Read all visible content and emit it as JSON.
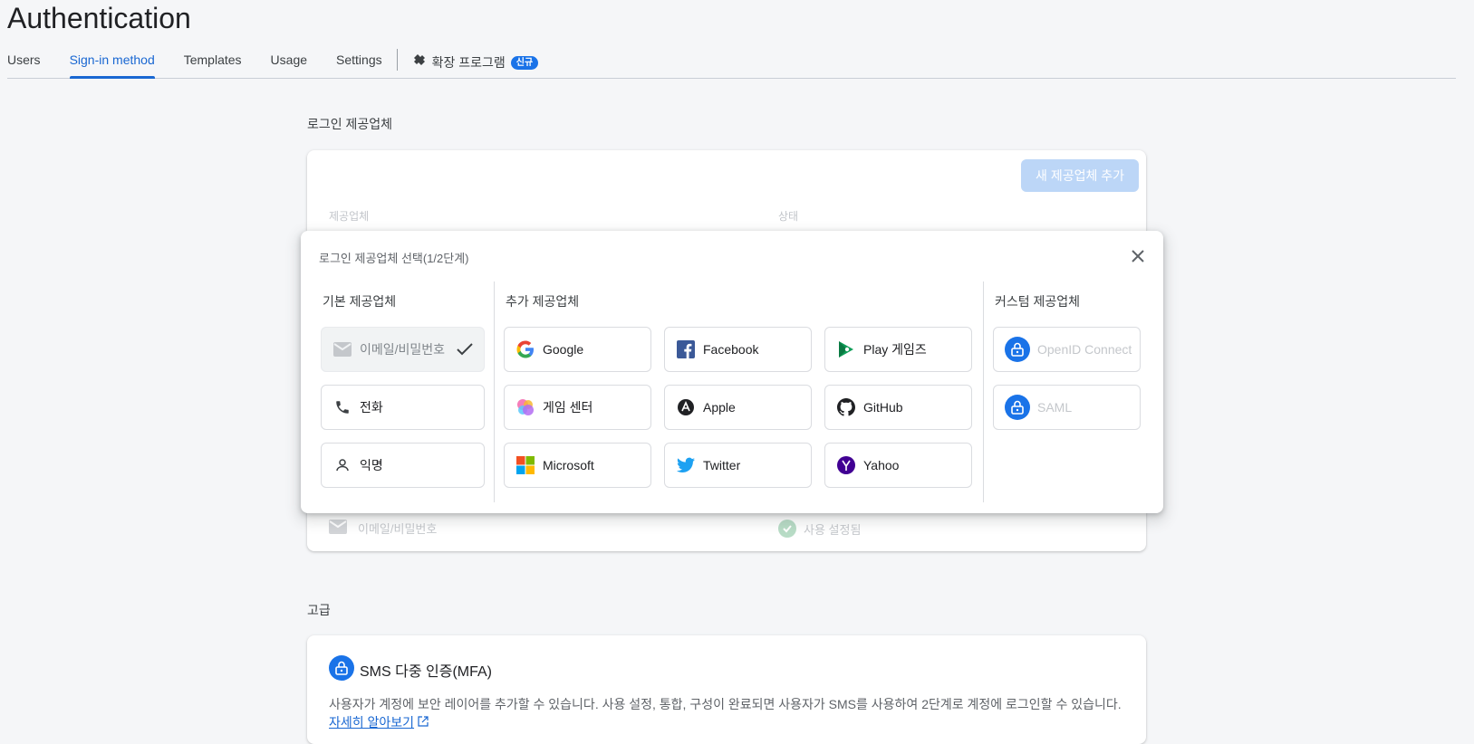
{
  "page_title": "Authentication",
  "tabs": [
    {
      "label": "Users"
    },
    {
      "label": "Sign-in method"
    },
    {
      "label": "Templates"
    },
    {
      "label": "Usage"
    },
    {
      "label": "Settings"
    }
  ],
  "extensions_tab": {
    "label": "확장 프로그램",
    "badge": "신규"
  },
  "providers_section": {
    "label": "로그인 제공업체",
    "add_button": "새 제공업체 추가",
    "col_provider": "제공업체",
    "col_status": "상태",
    "row": {
      "provider": "이메일/비밀번호",
      "status": "사용 설정됨"
    }
  },
  "modal": {
    "title": "로그인 제공업체 선택(1/2단계)",
    "groups": {
      "basic": "기본 제공업체",
      "additional": "추가 제공업체",
      "custom": "커스텀 제공업체"
    },
    "basic": [
      {
        "label": "이메일/비밀번호",
        "icon": "mail-icon"
      },
      {
        "label": "전화",
        "icon": "phone-icon"
      },
      {
        "label": "익명",
        "icon": "person-icon"
      }
    ],
    "additional": [
      {
        "label": "Google",
        "icon": "google-icon"
      },
      {
        "label": "Facebook",
        "icon": "facebook-icon"
      },
      {
        "label": "Play 게임즈",
        "icon": "play-games-icon"
      },
      {
        "label": "게임 센터",
        "icon": "game-center-icon"
      },
      {
        "label": "Apple",
        "icon": "apple-icon"
      },
      {
        "label": "GitHub",
        "icon": "github-icon"
      },
      {
        "label": "Microsoft",
        "icon": "microsoft-icon"
      },
      {
        "label": "Twitter",
        "icon": "twitter-icon"
      },
      {
        "label": "Yahoo",
        "icon": "yahoo-icon"
      }
    ],
    "custom": [
      {
        "label": "OpenID Connect",
        "icon": "lock-icon"
      },
      {
        "label": "SAML",
        "icon": "lock-icon"
      }
    ]
  },
  "advanced_section": {
    "label": "고급",
    "mfa_title": "SMS 다중 인증(MFA)",
    "mfa_desc": "사용자가 계정에 보안 레이어를 추가할 수 있습니다. 사용 설정, 통합, 구성이 완료되면 사용자가 SMS를 사용하여 2단계로 계정에 로그인할 수 있습니다.",
    "mfa_link": "자세히 알아보기"
  },
  "colors": {
    "accent": "#1a73e8",
    "active_tab": "#1967d2"
  }
}
